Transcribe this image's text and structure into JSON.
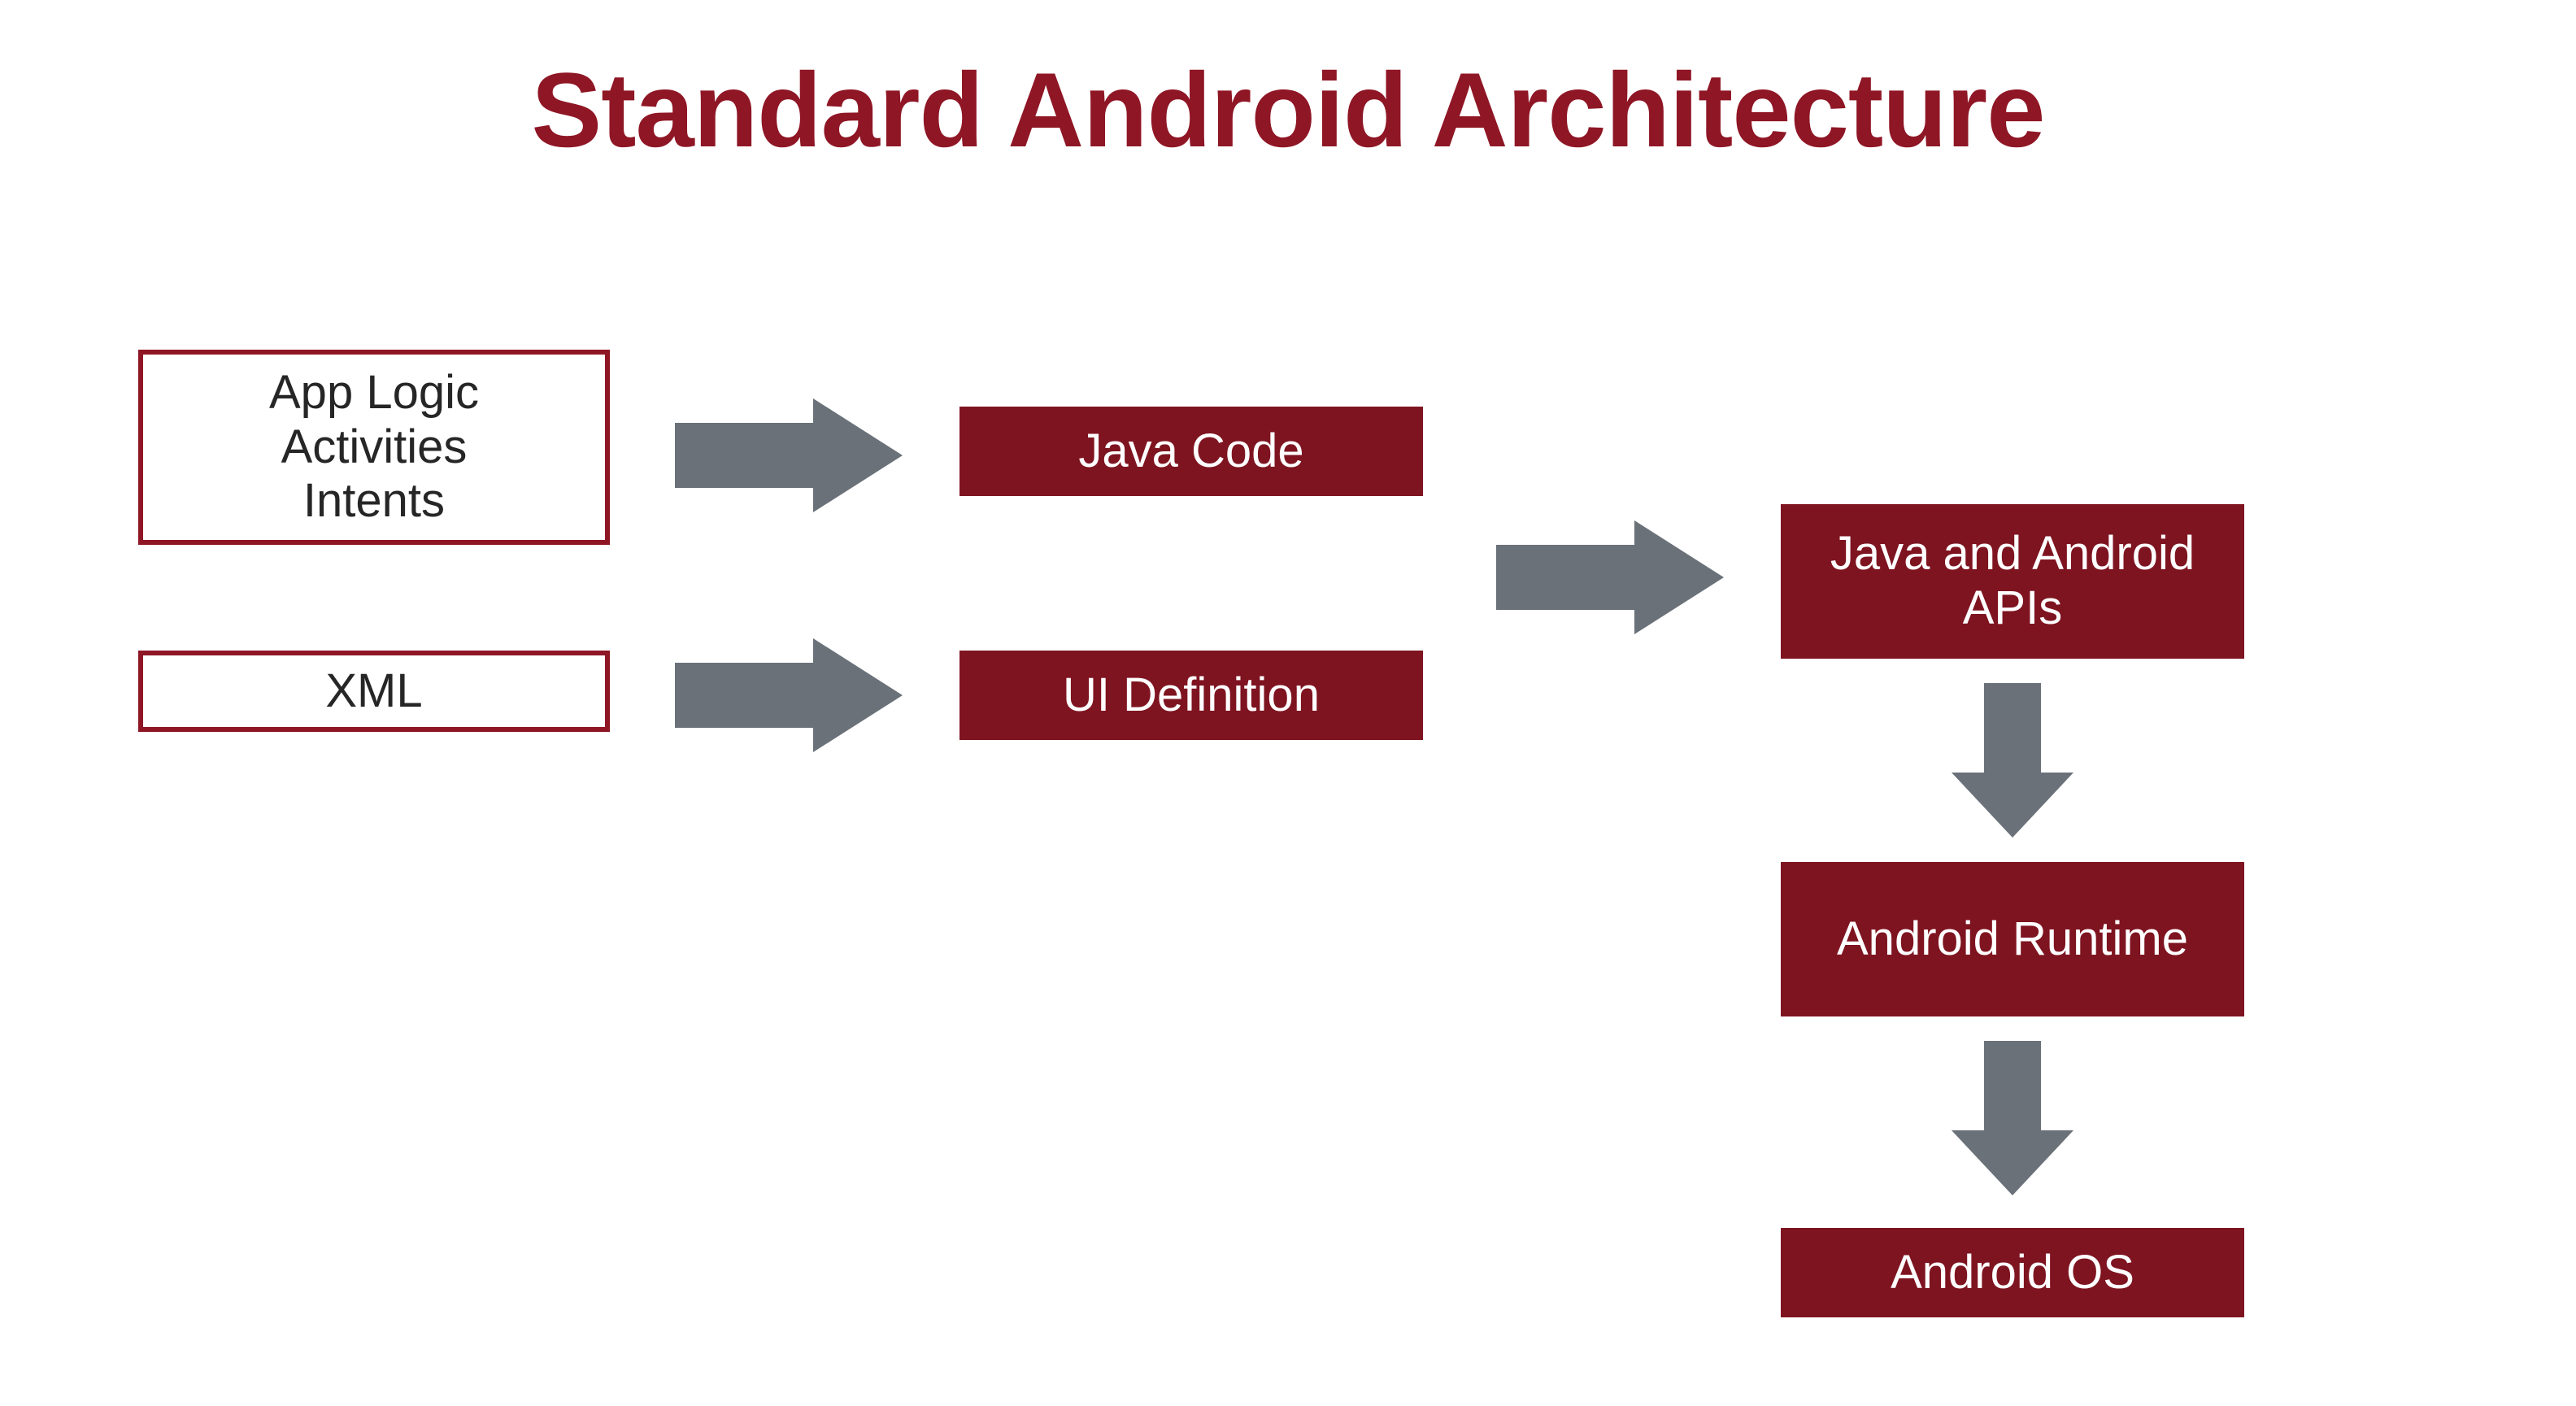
{
  "title": "Standard Android Architecture",
  "boxes": {
    "app_logic": "App Logic\nActivities\nIntents",
    "xml": "XML",
    "java_code": "Java Code",
    "ui_definition": "UI Definition",
    "java_android_apis": "Java and Android APIs",
    "android_runtime": "Android Runtime",
    "android_os": "Android OS"
  },
  "colors": {
    "title": "#8f1625",
    "box_border": "#8f1625",
    "box_fill": "#7e1420",
    "arrow": "#6a7179"
  }
}
